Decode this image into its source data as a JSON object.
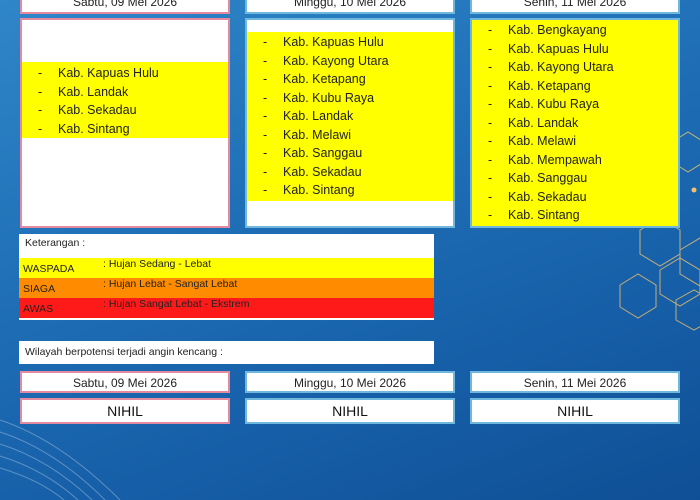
{
  "dates": {
    "d1": "Sabtu, 09 Mei 2026",
    "d2": "Minggu, 10 Mei 2026",
    "d3": "Senin, 11 Mei 2026"
  },
  "warnings": {
    "day1": [
      "Kab. Kapuas Hulu",
      "Kab. Landak",
      "Kab. Sekadau",
      "Kab. Sintang"
    ],
    "day2": [
      "Kab. Kapuas Hulu",
      "Kab. Kayong Utara",
      "Kab. Ketapang",
      "Kab. Kubu Raya",
      "Kab. Landak",
      "Kab. Melawi",
      "Kab. Sanggau",
      "Kab. Sekadau",
      "Kab. Sintang"
    ],
    "day3": [
      "Kab. Bengkayang",
      "Kab. Kapuas Hulu",
      "Kab. Kayong Utara",
      "Kab. Ketapang",
      "Kab. Kubu Raya",
      "Kab. Landak",
      "Kab. Melawi",
      "Kab. Mempawah",
      "Kab. Sanggau",
      "Kab. Sekadau",
      "Kab. Sintang"
    ],
    "dash": "-"
  },
  "legend": {
    "title": "Keterangan :",
    "levels": [
      {
        "name": "WASPADA",
        "desc": ": Hujan Sedang - Lebat",
        "color": "#ffff00"
      },
      {
        "name": "SIAGA",
        "desc": ": Hujan Lebat - Sangat Lebat",
        "color": "#ff8c00"
      },
      {
        "name": "AWAS",
        "desc": ": Hujan Sangat Lebat - Ekstrem",
        "color": "#ff1a1a"
      }
    ]
  },
  "wind": {
    "title": "Wilayah berpotensi terjadi angin kencang :",
    "d1": "NIHIL",
    "d2": "NIHIL",
    "d3": "NIHIL"
  },
  "colors": {
    "waspada": "#ffff00",
    "background": "#1f6fb6"
  }
}
